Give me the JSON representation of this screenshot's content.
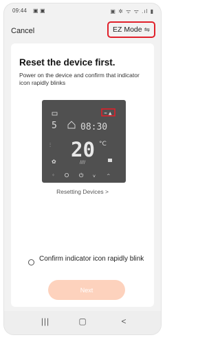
{
  "status_bar": {
    "time": "09:44",
    "left_icons": "▣ ▣",
    "right_icons": "▣ ✲ ᯤ ᯤ .ıl ▮"
  },
  "header": {
    "cancel_label": "Cancel",
    "mode_label": "EZ Mode",
    "mode_icon": "⇋"
  },
  "instructions": {
    "title": "Reset the device first.",
    "description": "Power on the device and confirm that indicator icon rapidly blinks"
  },
  "device_display": {
    "day": "5",
    "time": "08:30",
    "temperature": "20",
    "unit": "°C",
    "highlight_color": "#e0202a"
  },
  "reset_link": "Resetting Devices >",
  "confirm": {
    "label": "Confirm indicator icon rapidly blink",
    "checked": false
  },
  "next_button": {
    "label": "Next",
    "enabled": false,
    "color": "#fdd2bd"
  },
  "nav_bar": {
    "recent_icon": "|||",
    "home_icon": "▢",
    "back_icon": "<"
  }
}
